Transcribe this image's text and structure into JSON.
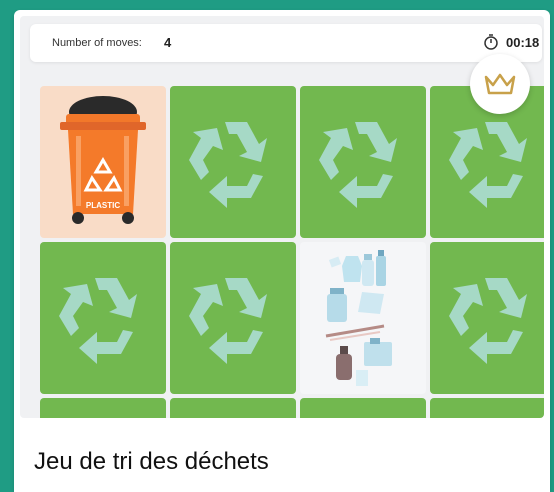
{
  "status_bar": {
    "moves_label": "Number of moves:",
    "moves_value": "4",
    "timer_value": "00:18"
  },
  "icons": {
    "timer": "stopwatch-icon",
    "crown": "crown-icon",
    "card_back": "recycle-icon"
  },
  "tiles": {
    "bin_label": "PLASTIC",
    "bin_type": "plastic-bin",
    "revealed_waste": "plastic-waste-items"
  },
  "colors": {
    "background": "#1f9c84",
    "card_back": "#72b84f",
    "recycle_symbol": "#a6d9c6",
    "bin_orange": "#f47a2a",
    "crown": "#c8a14a"
  },
  "footer": {
    "title": "Jeu de tri des déchets"
  }
}
